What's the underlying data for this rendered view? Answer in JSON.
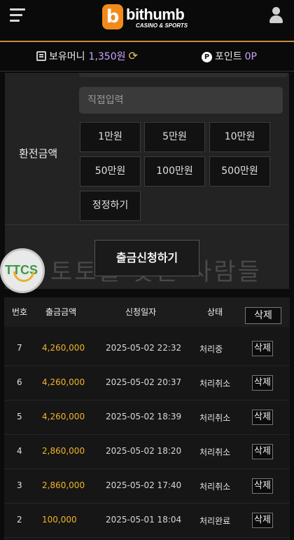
{
  "header": {
    "logo_letter": "b",
    "logo_text": "bithumb",
    "logo_sub": "CASINO & SPORTS"
  },
  "info": {
    "money_label": "보유머니",
    "money_value": "1,350원",
    "points_badge": "P",
    "points_label": "포인트",
    "points_value": "0P"
  },
  "form": {
    "amount_label": "환전금액",
    "input_placeholder": "직접입력",
    "amount_buttons": [
      "1만원",
      "5만원",
      "10만원",
      "50만원",
      "100만원",
      "500만원"
    ],
    "reset_label": "정정하기",
    "submit_label": "출금신청하기"
  },
  "watermark": {
    "logo_text": "TTCS",
    "text": "토토를 찾는 사람들"
  },
  "table": {
    "headers": [
      "번호",
      "출금금액",
      "신청일자",
      "상태"
    ],
    "delete_all_label": "삭제",
    "row_delete_label": "삭제",
    "rows": [
      {
        "no": "7",
        "amount": "4,260,000",
        "date": "2025-05-02 22:32",
        "status": "처리중"
      },
      {
        "no": "6",
        "amount": "4,260,000",
        "date": "2025-05-02 20:37",
        "status": "처리취소"
      },
      {
        "no": "5",
        "amount": "4,260,000",
        "date": "2025-05-02 18:39",
        "status": "처리취소"
      },
      {
        "no": "4",
        "amount": "2,860,000",
        "date": "2025-05-02 18:20",
        "status": "처리취소"
      },
      {
        "no": "3",
        "amount": "2,860,000",
        "date": "2025-05-02 17:40",
        "status": "처리취소"
      },
      {
        "no": "2",
        "amount": "100,000",
        "date": "2025-05-01 18:04",
        "status": "처리완료"
      }
    ]
  }
}
